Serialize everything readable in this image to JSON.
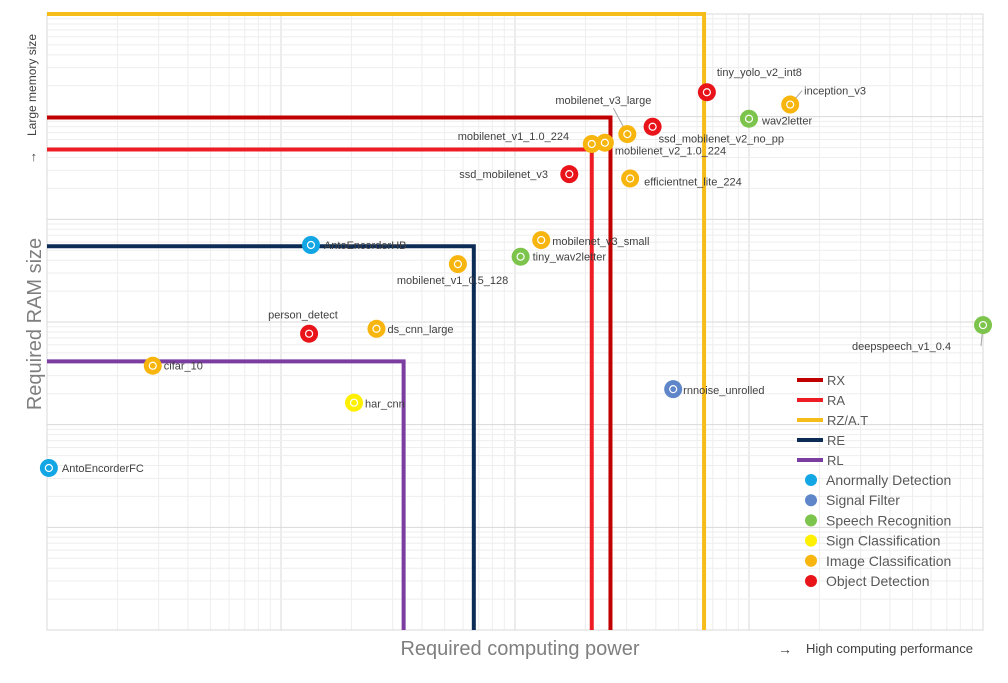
{
  "chart_data": {
    "type": "scatter",
    "title": "",
    "xlabel": "Required computing power",
    "ylabel": "Required RAM size",
    "x_axis_note": "High computing performance",
    "y_axis_note": "Large memory size",
    "x_arrow": "→",
    "y_arrow": "→",
    "xlim": [
      0,
      100
    ],
    "ylim": [
      0,
      100
    ],
    "grid": true,
    "legend_position": "bottom-right",
    "categories": [
      {
        "name": "Anormally Detection",
        "color": "#13a6e4"
      },
      {
        "name": "Signal Filter",
        "color": "#5f86c8"
      },
      {
        "name": "Speech Recognition",
        "color": "#7dc44c"
      },
      {
        "name": "Sign Classification",
        "color": "#ffef00"
      },
      {
        "name": "Image Classification",
        "color": "#f7b50e"
      },
      {
        "name": "Object Detection",
        "color": "#e8141a"
      }
    ],
    "thresholds": [
      {
        "name": "RX",
        "color": "#c00000",
        "x": 60.2,
        "y": 83.2
      },
      {
        "name": "RA",
        "color": "#ee1c24",
        "x": 58.2,
        "y": 78.0
      },
      {
        "name": "RZ/A.T",
        "color": "#f5bc1a",
        "x": 70.2,
        "y": 100
      },
      {
        "name": "RE",
        "color": "#0c2b55",
        "x": 45.6,
        "y": 62.3
      },
      {
        "name": "RL",
        "color": "#7b3ea0",
        "x": 38.1,
        "y": 43.6
      }
    ],
    "points": [
      {
        "label": "tiny_yolo_v2_int8",
        "category": "Object Detection",
        "x": 70.5,
        "y": 87.3
      },
      {
        "label": "inception_v3",
        "category": "Image Classification",
        "x": 79.4,
        "y": 85.3
      },
      {
        "label": "wav2letter",
        "category": "Speech Recognition",
        "x": 75.0,
        "y": 83.0
      },
      {
        "label": "mobilenet_v3_large",
        "category": "Image Classification",
        "x": 62.0,
        "y": 80.5
      },
      {
        "label": "ssd_mobilenet_v2_no_pp",
        "category": "Object Detection",
        "x": 64.7,
        "y": 81.7
      },
      {
        "label": "mobilenet_v1_1.0_224",
        "category": "Image Classification",
        "x": 58.2,
        "y": 78.9
      },
      {
        "label": "mobilenet_v2_1.0_224",
        "category": "Image Classification",
        "x": 59.6,
        "y": 79.1
      },
      {
        "label": "ssd_mobilenet_v3",
        "category": "Object Detection",
        "x": 55.8,
        "y": 74.0
      },
      {
        "label": "efficientnet_lite_224",
        "category": "Image Classification",
        "x": 62.3,
        "y": 73.3
      },
      {
        "label": "AntoEncorderHB",
        "category": "Anormally Detection",
        "x": 28.2,
        "y": 62.5
      },
      {
        "label": "mobilenet_v3_small",
        "category": "Image Classification",
        "x": 52.8,
        "y": 63.3
      },
      {
        "label": "tiny_wav2letter",
        "category": "Speech Recognition",
        "x": 50.6,
        "y": 60.6
      },
      {
        "label": "mobilenet_v1_0.5_128",
        "category": "Image Classification",
        "x": 43.9,
        "y": 59.4
      },
      {
        "label": "deepspeech_v1_0.4",
        "category": "Speech Recognition",
        "x": 100,
        "y": 49.5
      },
      {
        "label": "person_detect",
        "category": "Object Detection",
        "x": 28.0,
        "y": 48.1
      },
      {
        "label": "ds_cnn_large",
        "category": "Image Classification",
        "x": 35.2,
        "y": 48.9
      },
      {
        "label": "cifar_10",
        "category": "Image Classification",
        "x": 11.3,
        "y": 42.9
      },
      {
        "label": "rnnoise_unrolled",
        "category": "Signal Filter",
        "x": 66.9,
        "y": 39.1
      },
      {
        "label": "har_cnn",
        "category": "Sign Classification",
        "x": 32.8,
        "y": 36.9
      },
      {
        "label": "AntoEncorderFC",
        "category": "Anormally Detection",
        "x": 0.2,
        "y": 26.3
      }
    ]
  }
}
